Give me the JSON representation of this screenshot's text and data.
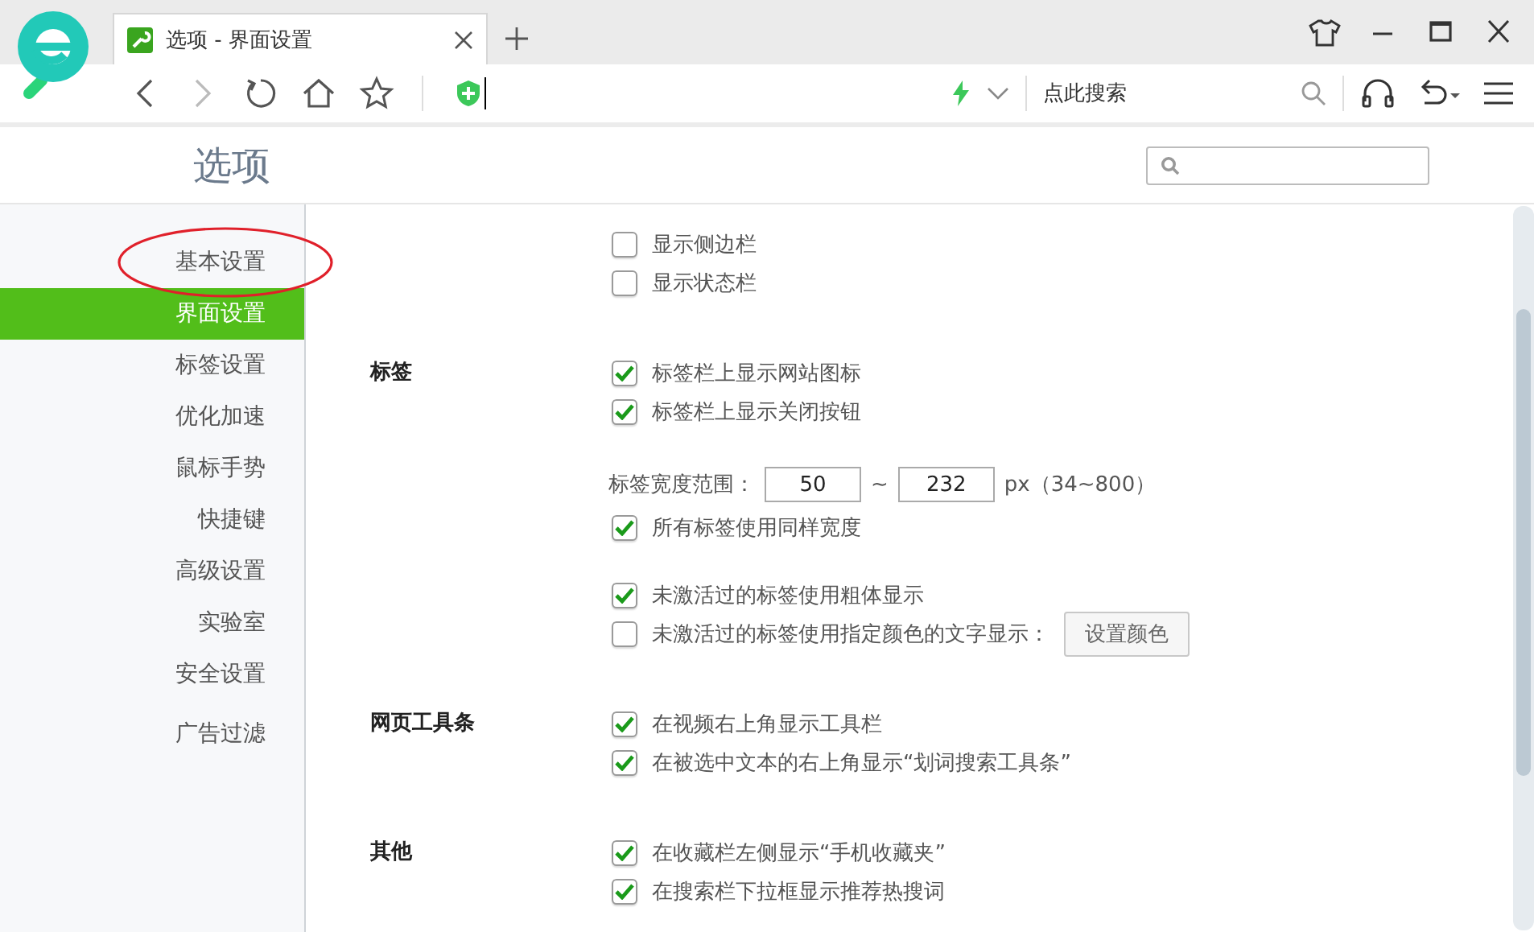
{
  "browser": {
    "tab": {
      "title": "选项 - 界面设置"
    },
    "search_placeholder": "点此搜索"
  },
  "page": {
    "title": "选项"
  },
  "sidebar": {
    "items": [
      {
        "label": "基本设置",
        "selected": false,
        "circled": true
      },
      {
        "label": "界面设置",
        "selected": true,
        "circled": false
      },
      {
        "label": "标签设置",
        "selected": false,
        "circled": false
      },
      {
        "label": "优化加速",
        "selected": false,
        "circled": false
      },
      {
        "label": "鼠标手势",
        "selected": false,
        "circled": false
      },
      {
        "label": "快捷键",
        "selected": false,
        "circled": false
      },
      {
        "label": "高级设置",
        "selected": false,
        "circled": false
      },
      {
        "label": "实验室",
        "selected": false,
        "circled": false
      },
      {
        "label": "安全设置",
        "selected": false,
        "circled": false
      },
      {
        "label": "广告过滤",
        "selected": false,
        "circled": false
      }
    ]
  },
  "sections": [
    {
      "groups": [
        [
          {
            "kind": "checkbox",
            "label": "显示侧边栏",
            "checked": false
          },
          {
            "kind": "checkbox",
            "label": "显示状态栏",
            "checked": false
          }
        ]
      ]
    },
    {
      "title": "标签",
      "groups": [
        [
          {
            "kind": "checkbox",
            "label": "标签栏上显示网站图标",
            "checked": true
          },
          {
            "kind": "checkbox",
            "label": "标签栏上显示关闭按钮",
            "checked": true
          }
        ],
        [
          {
            "kind": "range",
            "label": "标签宽度范围：",
            "from": "50",
            "separator": "~",
            "to": "232",
            "unit": "px（34~800）"
          },
          {
            "kind": "checkbox",
            "label": "所有标签使用同样宽度",
            "checked": true
          }
        ],
        [
          {
            "kind": "checkbox",
            "label": "未激活过的标签使用粗体显示",
            "checked": true
          },
          {
            "kind": "checkbox",
            "label": "未激活过的标签使用指定颜色的文字显示：",
            "checked": false,
            "button": "设置颜色"
          }
        ]
      ]
    },
    {
      "title": "网页工具条",
      "groups": [
        [
          {
            "kind": "checkbox",
            "label": "在视频右上角显示工具栏",
            "checked": true
          },
          {
            "kind": "checkbox",
            "label": "在被选中文本的右上角显示“划词搜索工具条”",
            "checked": true
          }
        ]
      ]
    },
    {
      "title": "其他",
      "groups": [
        [
          {
            "kind": "checkbox",
            "label": "在收藏栏左侧显示“手机收藏夹”",
            "checked": true
          },
          {
            "kind": "checkbox",
            "label": "在搜索栏下拉框显示推荐热搜词",
            "checked": true
          }
        ]
      ]
    }
  ]
}
